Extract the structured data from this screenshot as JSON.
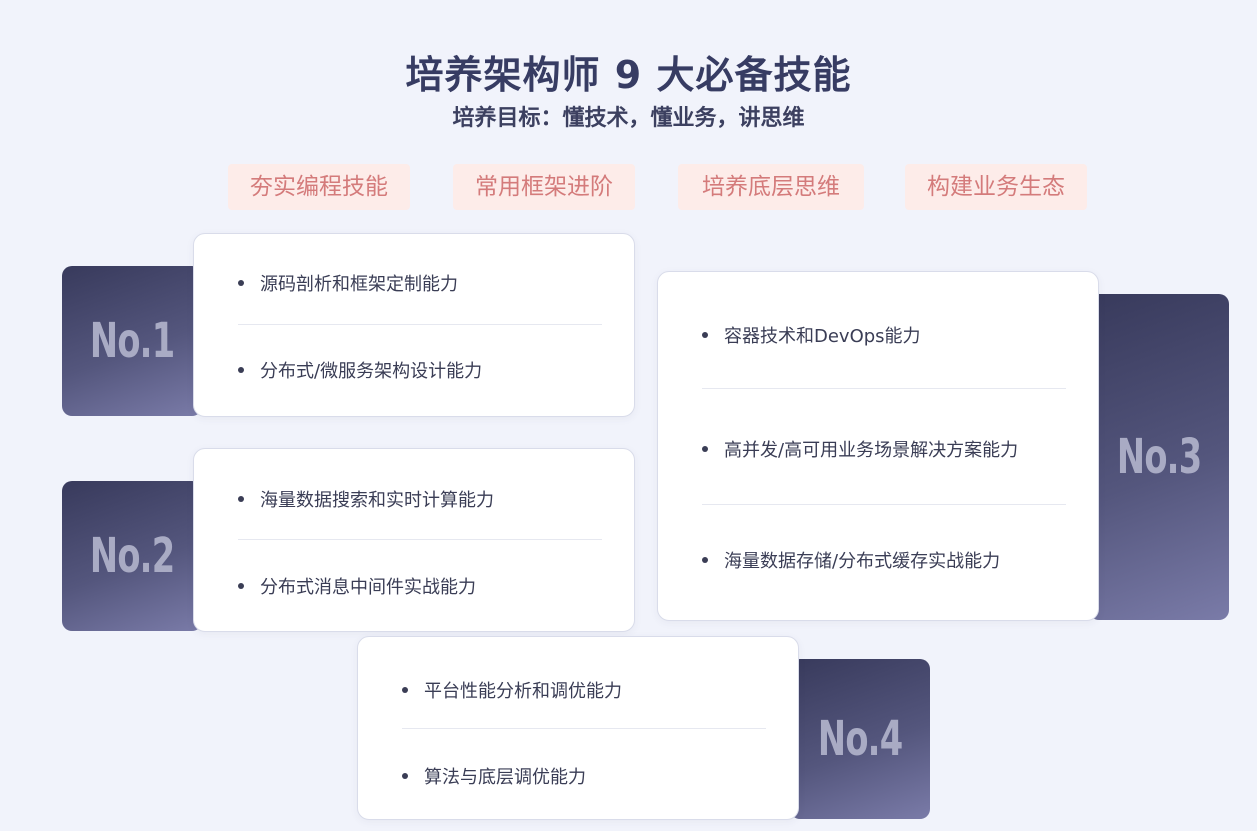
{
  "header": {
    "title": "培养架构师 9 大必备技能",
    "subtitle": "培养目标：懂技术，懂业务，讲思维"
  },
  "tags": [
    "夯实编程技能",
    "常用框架进阶",
    "培养底层思维",
    "构建业务生态"
  ],
  "groups": [
    {
      "badge": "No.1",
      "items": [
        "源码剖析和框架定制能力",
        "分布式/微服务架构设计能力"
      ]
    },
    {
      "badge": "No.2",
      "items": [
        "海量数据搜索和实时计算能力",
        "分布式消息中间件实战能力"
      ]
    },
    {
      "badge": "No.3",
      "items": [
        "容器技术和DevOps能力",
        "高并发/高可用业务场景解决方案能力",
        "海量数据存储/分布式缓存实战能力"
      ]
    },
    {
      "badge": "No.4",
      "items": [
        "平台性能分析和调优能力",
        "算法与底层调优能力"
      ]
    }
  ],
  "colors": {
    "background": "#f1f3fb",
    "badge_dark": "#383a5c",
    "badge_light": "#7a7ba8",
    "tag_bg": "#fdece9",
    "tag_text": "#d47b7b"
  }
}
